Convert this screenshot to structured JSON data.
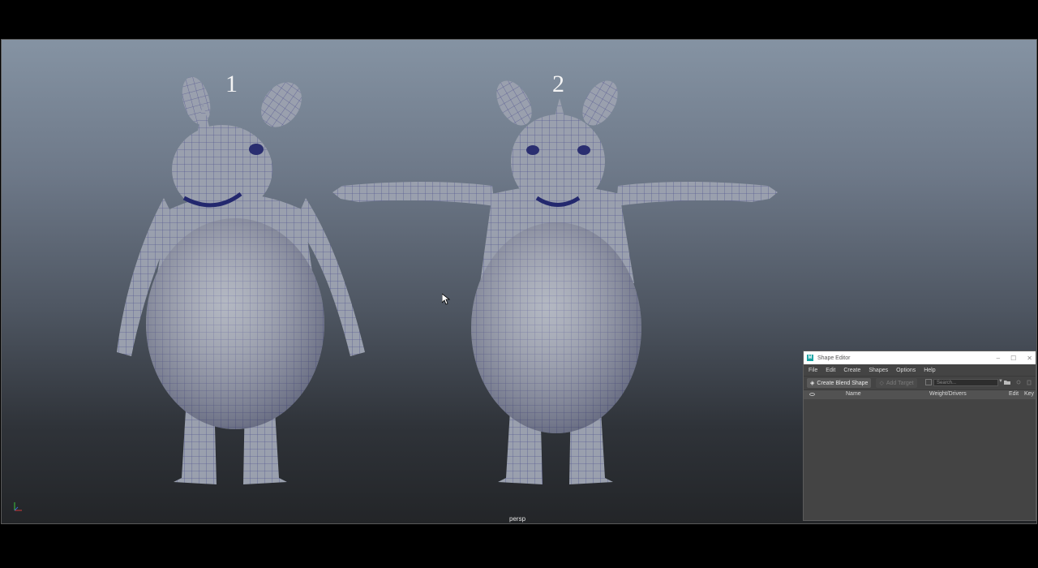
{
  "viewport": {
    "models": [
      {
        "label": "1"
      },
      {
        "label": "2"
      }
    ],
    "camera": "persp"
  },
  "shape_editor": {
    "title": "Shape Editor",
    "menu": [
      "File",
      "Edit",
      "Create",
      "Shapes",
      "Options",
      "Help"
    ],
    "toolbar": {
      "create_blend_shape": "Create Blend Shape",
      "add_target": "Add Target",
      "search_placeholder": "Search..."
    },
    "columns": {
      "name": "Name",
      "weight": "Weight/Drivers",
      "edit": "Edit",
      "key": "Key"
    }
  },
  "icons": {
    "window_minimize": "minimize-icon",
    "window_maximize": "maximize-icon",
    "window_close": "close-icon",
    "visibility": "eye-icon"
  },
  "colors": {
    "mesh_fill": "#9a9fae",
    "wire": "#4b4fb8",
    "app_accent": "#17a3a3"
  }
}
